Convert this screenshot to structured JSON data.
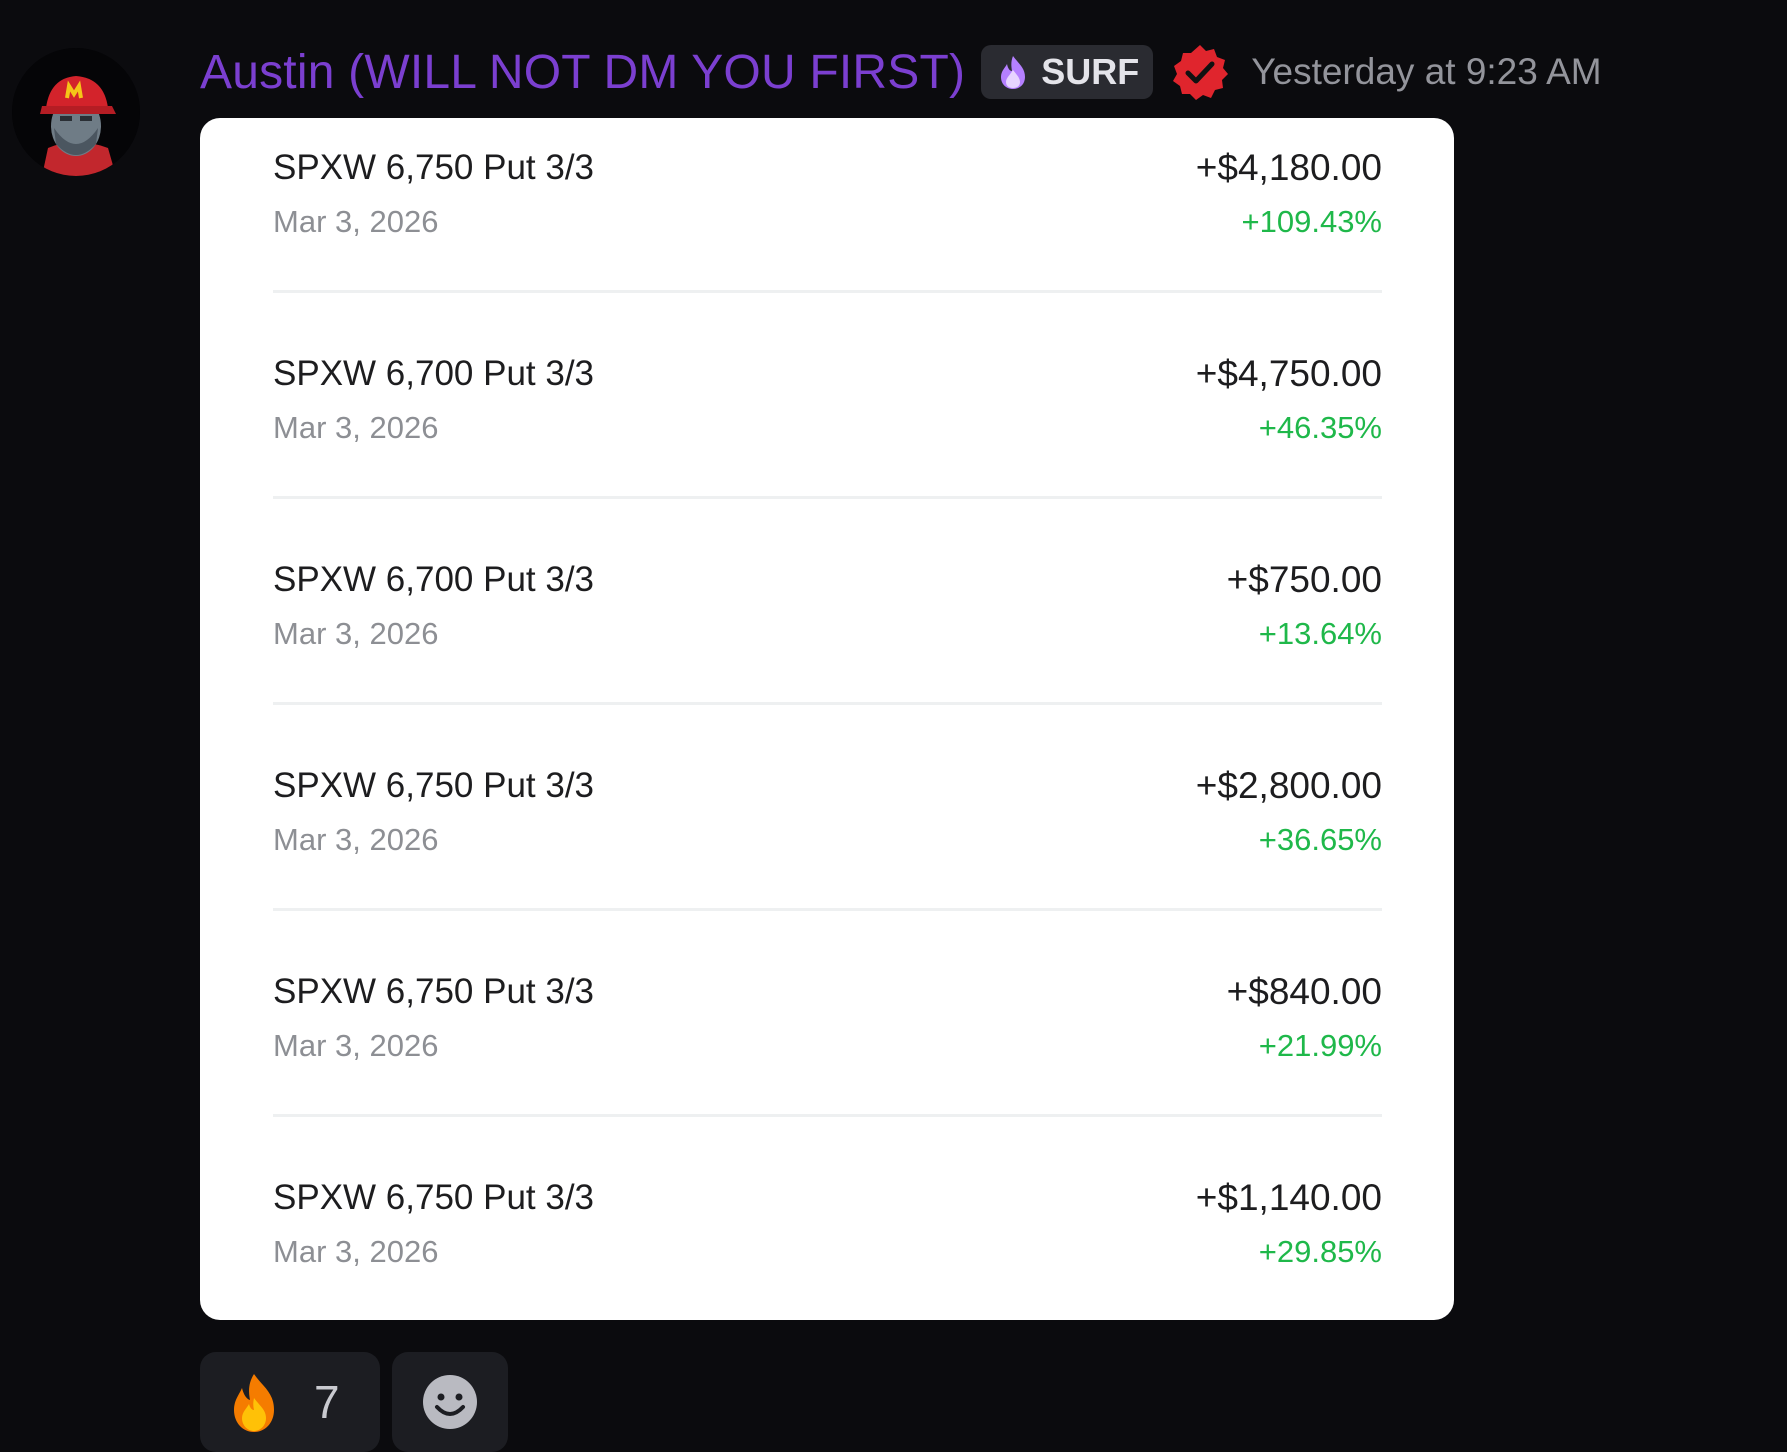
{
  "message": {
    "author": "Austin (WILL NOT DM YOU FIRST)",
    "tag": {
      "icon": "purple-flame-icon",
      "label": "SURF"
    },
    "verified_icon": "verified-badge-icon",
    "timestamp": "Yesterday at 9:23 AM",
    "avatar_icon": "avatar-red-cap"
  },
  "trades": [
    {
      "contract": "SPXW 6,750 Put 3/3",
      "date": "Mar 3, 2026",
      "amount": "+$4,180.00",
      "percent": "+109.43%"
    },
    {
      "contract": "SPXW 6,700 Put 3/3",
      "date": "Mar 3, 2026",
      "amount": "+$4,750.00",
      "percent": "+46.35%"
    },
    {
      "contract": "SPXW 6,700 Put 3/3",
      "date": "Mar 3, 2026",
      "amount": "+$750.00",
      "percent": "+13.64%"
    },
    {
      "contract": "SPXW 6,750 Put 3/3",
      "date": "Mar 3, 2026",
      "amount": "+$2,800.00",
      "percent": "+36.65%"
    },
    {
      "contract": "SPXW 6,750 Put 3/3",
      "date": "Mar 3, 2026",
      "amount": "+$840.00",
      "percent": "+21.99%"
    },
    {
      "contract": "SPXW 6,750 Put 3/3",
      "date": "Mar 3, 2026",
      "amount": "+$1,140.00",
      "percent": "+29.85%"
    }
  ],
  "reactions": [
    {
      "icon": "fire-emoji-icon",
      "count": "7"
    },
    {
      "icon": "add-reaction-smile-icon"
    }
  ],
  "colors": {
    "background": "#0b0b0e",
    "username": "#7b3fd0",
    "gain": "#1fb84a",
    "card": "#ffffff"
  }
}
